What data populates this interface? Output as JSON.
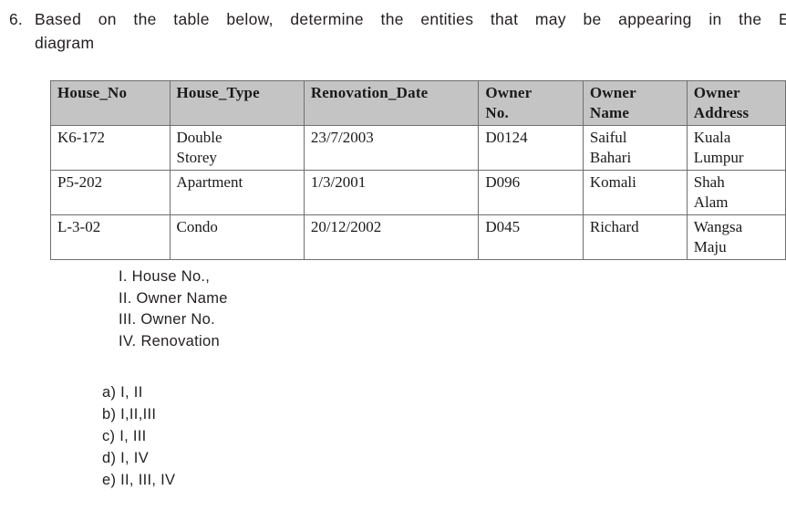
{
  "question": {
    "number": "6.",
    "line1": "Based on the table below, determine the entities that may be appearing in the E",
    "line2": "diagram",
    "full_text": "Based on the table below, determine the entities that may be appearing in the E"
  },
  "table": {
    "headers": [
      {
        "line1": "House_No",
        "line2": ""
      },
      {
        "line1": "House_Type",
        "line2": ""
      },
      {
        "line1": "Renovation_Date",
        "line2": ""
      },
      {
        "line1": "Owner",
        "line2": "No."
      },
      {
        "line1": "Owner",
        "line2": "Name"
      },
      {
        "line1": "Owner",
        "line2": "Address"
      }
    ],
    "rows": [
      {
        "house_no": "K6-172",
        "house_type_line1": "Double",
        "house_type_line2": "Storey",
        "renovation_date": "23/7/2003",
        "owner_no": "D0124",
        "owner_name_line1": "Saiful",
        "owner_name_line2": "Bahari",
        "owner_address_line1": "Kuala",
        "owner_address_line2": "Lumpur"
      },
      {
        "house_no": "P5-202",
        "house_type_line1": "Apartment",
        "house_type_line2": "",
        "renovation_date": "1/3/2001",
        "owner_no": "D096",
        "owner_name_line1": "Komali",
        "owner_name_line2": "",
        "owner_address_line1": "Shah",
        "owner_address_line2": "Alam"
      },
      {
        "house_no": "L-3-02",
        "house_type_line1": "Condo",
        "house_type_line2": "",
        "renovation_date": "20/12/2002",
        "owner_no": "D045",
        "owner_name_line1": "Richard",
        "owner_name_line2": "",
        "owner_address_line1": "Wangsa",
        "owner_address_line2": "Maju"
      }
    ],
    "header_background": "#c4c4c4",
    "border_color": "#6f6f6f"
  },
  "roman_list": [
    {
      "label": "I. House No.,"
    },
    {
      "label": "II. Owner Name"
    },
    {
      "label": "III. Owner No."
    },
    {
      "label": "IV. Renovation"
    }
  ],
  "options": [
    {
      "label": "a) I, II"
    },
    {
      "label": "b) I,II,III"
    },
    {
      "label": "c) I, III"
    },
    {
      "label": "d) I, IV"
    },
    {
      "label": "e) II, III, IV"
    }
  ]
}
